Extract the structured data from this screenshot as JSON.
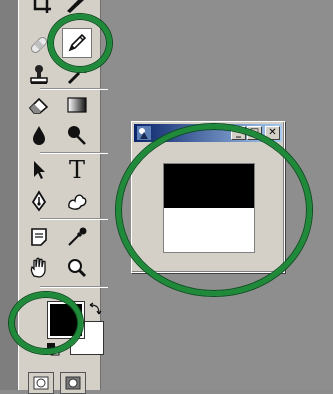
{
  "toolbox": {
    "tools": [
      {
        "name": "crop-tool",
        "icon": "crop-icon"
      },
      {
        "name": "slice-tool",
        "icon": "slice-icon"
      },
      {
        "name": "healing-brush-tool",
        "icon": "bandage-icon"
      },
      {
        "name": "pencil-tool",
        "icon": "pencil-icon",
        "selected": true
      },
      {
        "name": "clone-stamp-tool",
        "icon": "stamp-icon"
      },
      {
        "name": "history-brush-tool",
        "icon": "history-brush-icon"
      },
      {
        "name": "eraser-tool",
        "icon": "eraser-icon"
      },
      {
        "name": "gradient-tool",
        "icon": "gradient-icon"
      },
      {
        "name": "blur-tool",
        "icon": "drop-icon"
      },
      {
        "name": "dodge-tool",
        "icon": "dodge-icon"
      },
      {
        "name": "path-selection-tool",
        "icon": "arrow-icon"
      },
      {
        "name": "type-tool",
        "icon": "type-icon",
        "label": "T"
      },
      {
        "name": "pen-tool",
        "icon": "pen-nib-icon"
      },
      {
        "name": "custom-shape-tool",
        "icon": "shape-icon"
      },
      {
        "name": "notes-tool",
        "icon": "notes-icon"
      },
      {
        "name": "eyedropper-tool",
        "icon": "eyedropper-icon"
      },
      {
        "name": "hand-tool",
        "icon": "hand-icon"
      },
      {
        "name": "zoom-tool",
        "icon": "magnifier-icon"
      }
    ],
    "foreground_color": "#000000",
    "background_color": "#ffffff"
  },
  "document_window": {
    "buttons": {
      "minimize": "_",
      "maximize": "□",
      "close": "✕"
    },
    "canvas_top_color": "#000000",
    "canvas_bottom_color": "#ffffff"
  },
  "annotation_color": "#1f8a3a"
}
